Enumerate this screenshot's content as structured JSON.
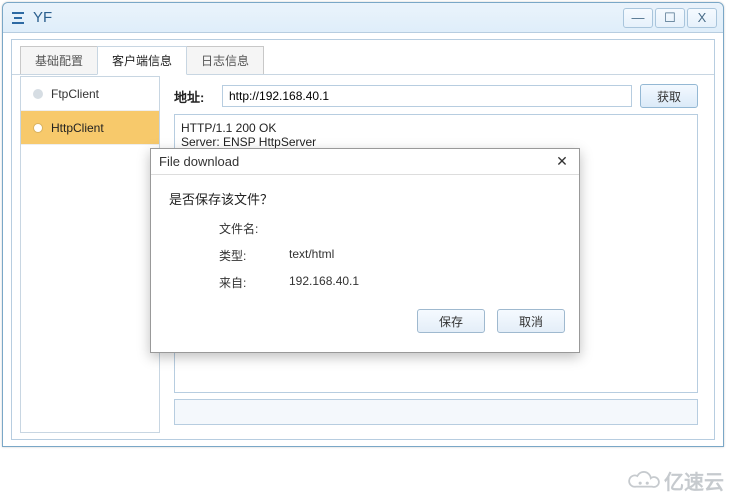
{
  "window": {
    "title": "YF",
    "min": "—",
    "max": "☐",
    "close": "X"
  },
  "tabs": [
    {
      "label": "基础配置"
    },
    {
      "label": "客户端信息"
    },
    {
      "label": "日志信息"
    }
  ],
  "sidebar": [
    {
      "label": "FtpClient"
    },
    {
      "label": "HttpClient"
    }
  ],
  "address": {
    "label": "地址:",
    "value": "http://192.168.40.1",
    "button": "获取"
  },
  "response": "HTTP/1.1 200 OK\nServer: ENSP HttpServer\nAuth: HUAWEI",
  "dialog": {
    "title": "File download",
    "question": "是否保存该文件？",
    "rows": [
      {
        "k": "文件名:",
        "v": ""
      },
      {
        "k": "类型:",
        "v": "text/html"
      },
      {
        "k": "来自:",
        "v": "192.168.40.1"
      }
    ],
    "save": "保存",
    "cancel": "取消"
  },
  "watermark": "亿速云"
}
